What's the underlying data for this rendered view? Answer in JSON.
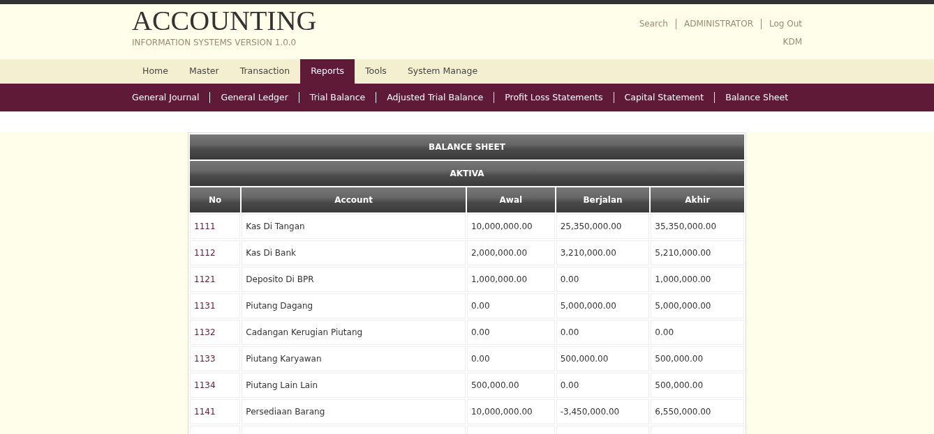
{
  "header": {
    "title": "ACCOUNTING",
    "subtitle": "INFORMATION SYSTEMS VERSION 1.0.0",
    "links": [
      "Search",
      "ADMINISTRATOR",
      "Log Out"
    ],
    "user": "KDM"
  },
  "tabs": [
    {
      "label": "Home",
      "selected": false
    },
    {
      "label": "Master",
      "selected": false
    },
    {
      "label": "Transaction",
      "selected": false
    },
    {
      "label": "Reports",
      "selected": true
    },
    {
      "label": "Tools",
      "selected": false
    },
    {
      "label": "System Manage",
      "selected": false
    }
  ],
  "submenu": [
    "General Journal",
    "General Ledger",
    "Trial Balance",
    "Adjusted Trial Balance",
    "Profit Loss Statements",
    "Capital Statement",
    "Balance Sheet"
  ],
  "report": {
    "title": "BALANCE SHEET",
    "section": "AKTIVA",
    "columns": [
      "No",
      "Account",
      "Awal",
      "Berjalan",
      "Akhir"
    ],
    "rows": [
      [
        "1111",
        "Kas Di Tangan",
        "10,000,000.00",
        "25,350,000.00",
        "35,350,000.00"
      ],
      [
        "1112",
        "Kas Di Bank",
        "2,000,000.00",
        "3,210,000.00",
        "5,210,000.00"
      ],
      [
        "1121",
        "Deposito Di BPR",
        "1,000,000.00",
        "0.00",
        "1,000,000.00"
      ],
      [
        "1131",
        "Piutang Dagang",
        "0.00",
        "5,000,000.00",
        "5,000,000.00"
      ],
      [
        "1132",
        "Cadangan Kerugian Piutang",
        "0.00",
        "0.00",
        "0.00"
      ],
      [
        "1133",
        "Piutang Karyawan",
        "0.00",
        "500,000.00",
        "500,000.00"
      ],
      [
        "1134",
        "Piutang Lain Lain",
        "500,000.00",
        "0.00",
        "500,000.00"
      ],
      [
        "1141",
        "Persediaan Barang",
        "10,000,000.00",
        "-3,450,000.00",
        "6,550,000.00"
      ]
    ]
  }
}
